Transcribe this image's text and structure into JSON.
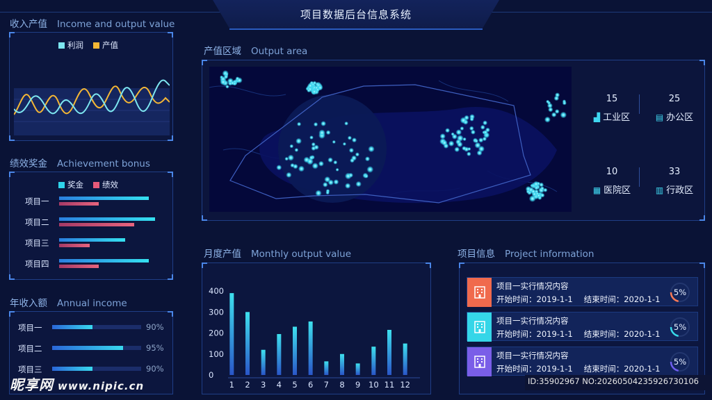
{
  "header": {
    "title": "项目数据后台信息系统"
  },
  "income_output": {
    "title": "收入产值",
    "title_en": "Income and output value",
    "legend": [
      {
        "name": "利润",
        "color": "#7de6f0"
      },
      {
        "name": "产值",
        "color": "#f5b735"
      }
    ]
  },
  "achievement": {
    "title": "绩效奖金",
    "title_en": "Achievement bonus",
    "legend": [
      {
        "name": "奖金",
        "color": "#2fd3ea"
      },
      {
        "name": "绩效",
        "color": "#e65a7a"
      }
    ],
    "rows": [
      {
        "label": "项目一",
        "bonus": 0.86,
        "perf": 0.38
      },
      {
        "label": "项目二",
        "bonus": 0.92,
        "perf": 0.72
      },
      {
        "label": "项目三",
        "bonus": 0.63,
        "perf": 0.29
      },
      {
        "label": "项目四",
        "bonus": 0.86,
        "perf": 0.38
      }
    ]
  },
  "annual": {
    "title": "年收入额",
    "title_en": "Annual income",
    "rows": [
      {
        "label": "项目一",
        "value": "90%",
        "fill": 0.45
      },
      {
        "label": "项目二",
        "value": "95%",
        "fill": 0.8
      },
      {
        "label": "项目三",
        "value": "90%",
        "fill": 0.45
      }
    ]
  },
  "output_area": {
    "title": "产值区域",
    "title_en": "Output area",
    "stats": [
      {
        "value": "15",
        "label": "工业区",
        "icon": "factory-icon"
      },
      {
        "value": "25",
        "label": "办公区",
        "icon": "office-icon"
      },
      {
        "value": "10",
        "label": "医院区",
        "icon": "hospital-icon"
      },
      {
        "value": "33",
        "label": "行政区",
        "icon": "admin-building-icon"
      }
    ]
  },
  "monthly": {
    "title": "月度产值",
    "title_en": "Monthly output value"
  },
  "chart_data": {
    "type": "bar",
    "categories": [
      "1",
      "2",
      "3",
      "4",
      "5",
      "6",
      "7",
      "8",
      "9",
      "10",
      "11",
      "12"
    ],
    "values": [
      390,
      300,
      120,
      195,
      230,
      255,
      65,
      100,
      55,
      135,
      215,
      150
    ],
    "yticks": [
      0,
      100,
      200,
      300,
      400
    ],
    "ylim": [
      0,
      430
    ],
    "grid": false,
    "color_top": "#3ee0ee",
    "color_bottom": "#2a56c8"
  },
  "project_info": {
    "title": "项目信息",
    "title_en": "Project information",
    "items": [
      {
        "name": "项目一实行情况内容",
        "start_label": "开始时间：",
        "start": "2019-1-1",
        "end_label": "结束时间：",
        "end": "2020-1-1",
        "percent": "5%",
        "percent_value": 0.05,
        "icon_color": "#f06a4d",
        "ring_color": "#ff7a55"
      },
      {
        "name": "项目一实行情况内容",
        "start_label": "开始时间：",
        "start": "2019-1-1",
        "end_label": "结束时间：",
        "end": "2020-1-1",
        "percent": "5%",
        "percent_value": 0.05,
        "icon_color": "#35d6e8",
        "ring_color": "#38d9ea"
      },
      {
        "name": "项目一实行情况内容",
        "start_label": "开始时间：",
        "start": "2019-1-1",
        "end_label": "结束时间：",
        "end": "2020-1-1",
        "percent": "5%",
        "percent_value": 0.05,
        "icon_color": "#7a5ee8",
        "ring_color": "#6f5ef0"
      }
    ]
  },
  "watermark": {
    "brand": "昵享网",
    "url": "www.nipic.cn",
    "id_line": "ID:35902967 NO:20260504235926730106"
  }
}
